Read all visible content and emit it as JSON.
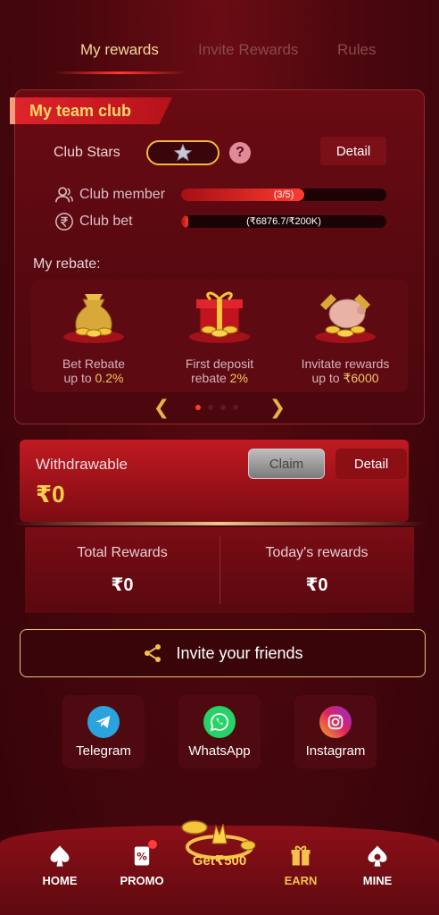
{
  "tabs": [
    {
      "label": "My rewards",
      "active": true
    },
    {
      "label": "Invite Rewards",
      "active": false
    },
    {
      "label": "Rules",
      "active": false
    }
  ],
  "club": {
    "title": "My team club",
    "stars_label": "Club Stars",
    "help_label": "?",
    "detail_label": "Detail",
    "member_label": "Club member",
    "member_text": "(3/5)",
    "member_progress": 0.6,
    "bet_label": "Club bet",
    "bet_text": "(₹6876.7/₹200K)",
    "bet_progress": 0.034
  },
  "rebate": {
    "label": "My rebate:",
    "items": [
      {
        "line1": "Bet Rebate",
        "line2_prefix": "up to ",
        "line2_value": "0.2%"
      },
      {
        "line1": "First deposit",
        "line2_prefix": "rebate ",
        "line2_value": "2%"
      },
      {
        "line1": "Invitate rewards",
        "line2_prefix": "up to ",
        "line2_value": "₹6000"
      }
    ],
    "pager_prev": "❮",
    "pager_next": "❯"
  },
  "withdraw": {
    "label": "Withdrawable",
    "amount": "₹0",
    "claim_label": "Claim",
    "detail_label": "Detail"
  },
  "rewards": {
    "total_label": "Total Rewards",
    "total_value": "₹0",
    "today_label": "Today's rewards",
    "today_value": "₹0"
  },
  "invite": {
    "label": "Invite your friends"
  },
  "social": [
    {
      "name": "Telegram",
      "color": "#2aa3df"
    },
    {
      "name": "WhatsApp",
      "color": "#25d366"
    },
    {
      "name": "Instagram",
      "color": "#d62f7c"
    }
  ],
  "nav": {
    "home": "HOME",
    "promo": "PROMO",
    "earn_center": "Get₹500",
    "earn": "EARN",
    "mine": "MINE"
  },
  "colors": {
    "accent_gold": "#f4c248",
    "accent_red": "#ff3b2f",
    "background": "#4a070d"
  }
}
